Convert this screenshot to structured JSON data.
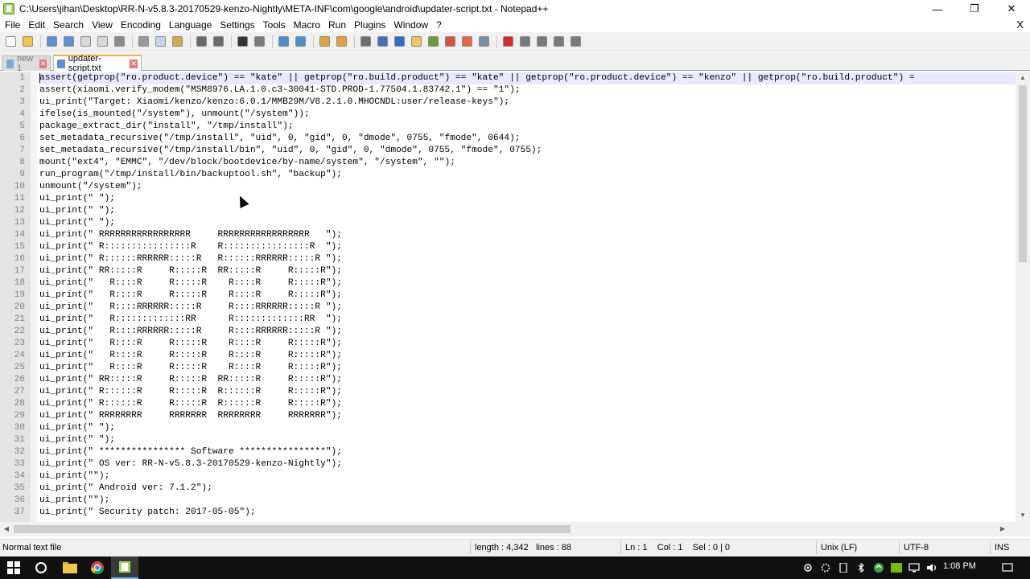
{
  "window": {
    "title": "C:\\Users\\jihan\\Desktop\\RR-N-v5.8.3-20170529-kenzo-Nightly\\META-INF\\com\\google\\android\\updater-script.txt - Notepad++",
    "minimize_glyph": "—",
    "maximize_glyph": "❐",
    "close_glyph": "✕"
  },
  "menu": {
    "items": [
      "File",
      "Edit",
      "Search",
      "View",
      "Encoding",
      "Language",
      "Settings",
      "Tools",
      "Macro",
      "Run",
      "Plugins",
      "Window",
      "?"
    ],
    "close_glyph": "X"
  },
  "toolbar": {
    "buttons": [
      {
        "name": "new-file",
        "color": "#ffffff"
      },
      {
        "name": "open-file",
        "color": "#f2c649"
      },
      {
        "name": "save",
        "color": "#5b8fd6"
      },
      {
        "name": "save-all",
        "color": "#5b8fd6"
      },
      {
        "name": "close",
        "color": "#d9d9d9"
      },
      {
        "name": "close-all",
        "color": "#d9d9d9"
      },
      {
        "name": "print",
        "color": "#8c8c8c"
      },
      {
        "name": "cut",
        "color": "#9a9a9a"
      },
      {
        "name": "copy",
        "color": "#c6d4e6"
      },
      {
        "name": "paste",
        "color": "#d4a94c"
      },
      {
        "name": "undo",
        "color": "#6b6b6b"
      },
      {
        "name": "redo",
        "color": "#6b6b6b"
      },
      {
        "name": "find",
        "color": "#333333"
      },
      {
        "name": "replace",
        "color": "#7a7a7a"
      },
      {
        "name": "zoom-in",
        "color": "#4c8fd1"
      },
      {
        "name": "zoom-out",
        "color": "#4c8fd1"
      },
      {
        "name": "sync-vertical",
        "color": "#e3a33b"
      },
      {
        "name": "sync-horizontal",
        "color": "#e3a33b"
      },
      {
        "name": "word-wrap",
        "color": "#6f6f6f"
      },
      {
        "name": "show-all-chars",
        "color": "#4a6fb5"
      },
      {
        "name": "indent-guide",
        "color": "#2d6fc4"
      },
      {
        "name": "user-language",
        "color": "#f0c75a"
      },
      {
        "name": "doc-map",
        "color": "#6a9b3c"
      },
      {
        "name": "function-list",
        "color": "#d4553a"
      },
      {
        "name": "folder-workspace",
        "color": "#e2673e"
      },
      {
        "name": "monitoring",
        "color": "#7a8fa6"
      },
      {
        "name": "record-macro",
        "color": "#d52a2a"
      },
      {
        "name": "stop-macro",
        "color": "#7a7a7a"
      },
      {
        "name": "play-macro",
        "color": "#7a7a7a"
      },
      {
        "name": "play-multiple",
        "color": "#7a7a7a"
      },
      {
        "name": "save-macro",
        "color": "#7a7a7a"
      }
    ]
  },
  "tabs": [
    {
      "label": "new 1",
      "active": false,
      "icon_color": "#7ea6d8"
    },
    {
      "label": "updater-script.txt",
      "active": true,
      "icon_color": "#5b8fd6"
    }
  ],
  "editor": {
    "lines": [
      {
        "num": "1",
        "text": "assert(getprop(\"ro.product.device\") == \"kate\" || getprop(\"ro.build.product\") == \"kate\" || getprop(\"ro.product.device\") == \"kenzo\" || getprop(\"ro.build.product\") =",
        "current": true
      },
      {
        "num": "2",
        "text": "assert(xiaomi.verify_modem(\"MSM8976.LA.1.0.c3-30041-STD.PROD-1.77504.1.83742.1\") == \"1\");"
      },
      {
        "num": "3",
        "text": "ui_print(\"Target: Xiaomi/kenzo/kenzo:6.0.1/MMB29M/V8.2.1.0.MHOCNDL:user/release-keys\");"
      },
      {
        "num": "4",
        "text": "ifelse(is_mounted(\"/system\"), unmount(\"/system\"));"
      },
      {
        "num": "5",
        "text": "package_extract_dir(\"install\", \"/tmp/install\");"
      },
      {
        "num": "6",
        "text": "set_metadata_recursive(\"/tmp/install\", \"uid\", 0, \"gid\", 0, \"dmode\", 0755, \"fmode\", 0644);"
      },
      {
        "num": "7",
        "text": "set_metadata_recursive(\"/tmp/install/bin\", \"uid\", 0, \"gid\", 0, \"dmode\", 0755, \"fmode\", 0755);"
      },
      {
        "num": "8",
        "text": "mount(\"ext4\", \"EMMC\", \"/dev/block/bootdevice/by-name/system\", \"/system\", \"\");"
      },
      {
        "num": "9",
        "text": "run_program(\"/tmp/install/bin/backuptool.sh\", \"backup\");"
      },
      {
        "num": "10",
        "text": "unmount(\"/system\");"
      },
      {
        "num": "11",
        "text": "ui_print(\" \");"
      },
      {
        "num": "12",
        "text": "ui_print(\" \");"
      },
      {
        "num": "13",
        "text": "ui_print(\" \");"
      },
      {
        "num": "14",
        "text": "ui_print(\" RRRRRRRRRRRRRRRRR     RRRRRRRRRRRRRRRRR   \");"
      },
      {
        "num": "15",
        "text": "ui_print(\" R::::::::::::::::R    R::::::::::::::::R  \");"
      },
      {
        "num": "16",
        "text": "ui_print(\" R::::::RRRRRR:::::R   R::::::RRRRRR:::::R \");"
      },
      {
        "num": "17",
        "text": "ui_print(\" RR:::::R     R:::::R  RR:::::R     R:::::R\");"
      },
      {
        "num": "18",
        "text": "ui_print(\"   R::::R     R:::::R    R::::R     R:::::R\");"
      },
      {
        "num": "19",
        "text": "ui_print(\"   R::::R     R:::::R    R::::R     R:::::R\");"
      },
      {
        "num": "20",
        "text": "ui_print(\"   R::::RRRRRR:::::R     R::::RRRRRR:::::R \");"
      },
      {
        "num": "21",
        "text": "ui_print(\"   R:::::::::::::RR      R:::::::::::::RR  \");"
      },
      {
        "num": "22",
        "text": "ui_print(\"   R::::RRRRRR:::::R     R::::RRRRRR:::::R \");"
      },
      {
        "num": "23",
        "text": "ui_print(\"   R::::R     R:::::R    R::::R     R:::::R\");"
      },
      {
        "num": "24",
        "text": "ui_print(\"   R::::R     R:::::R    R::::R     R:::::R\");"
      },
      {
        "num": "25",
        "text": "ui_print(\"   R::::R     R:::::R    R::::R     R:::::R\");"
      },
      {
        "num": "26",
        "text": "ui_print(\" RR:::::R     R:::::R  RR:::::R     R:::::R\");"
      },
      {
        "num": "27",
        "text": "ui_print(\" R::::::R     R:::::R  R::::::R     R:::::R\");"
      },
      {
        "num": "28",
        "text": "ui_print(\" R::::::R     R:::::R  R::::::R     R:::::R\");"
      },
      {
        "num": "29",
        "text": "ui_print(\" RRRRRRRR     RRRRRRR  RRRRRRRR     RRRRRRR\");"
      },
      {
        "num": "30",
        "text": "ui_print(\" \");"
      },
      {
        "num": "31",
        "text": "ui_print(\" \");"
      },
      {
        "num": "32",
        "text": "ui_print(\" **************** Software ****************\");"
      },
      {
        "num": "33",
        "text": "ui_print(\" OS ver: RR-N-v5.8.3-20170529-kenzo-Nightly\");"
      },
      {
        "num": "34",
        "text": "ui_print(\"\");"
      },
      {
        "num": "35",
        "text": "ui_print(\" Android ver: 7.1.2\");"
      },
      {
        "num": "36",
        "text": "ui_print(\"\");"
      },
      {
        "num": "37",
        "text": "ui_print(\" Security patch: 2017-05-05\");"
      }
    ]
  },
  "scroll": {
    "up": "▲",
    "down": "▼",
    "left": "◀",
    "right": "▶"
  },
  "statusbar": {
    "type": "Normal text file",
    "length": "length : 4,342",
    "lines": "lines : 88",
    "position": "Ln : 1    Col : 1    Sel : 0 | 0",
    "eol": "Unix (LF)",
    "encoding": "UTF-8",
    "mode": "INS"
  },
  "taskbar": {
    "time": "1:08 PM"
  }
}
